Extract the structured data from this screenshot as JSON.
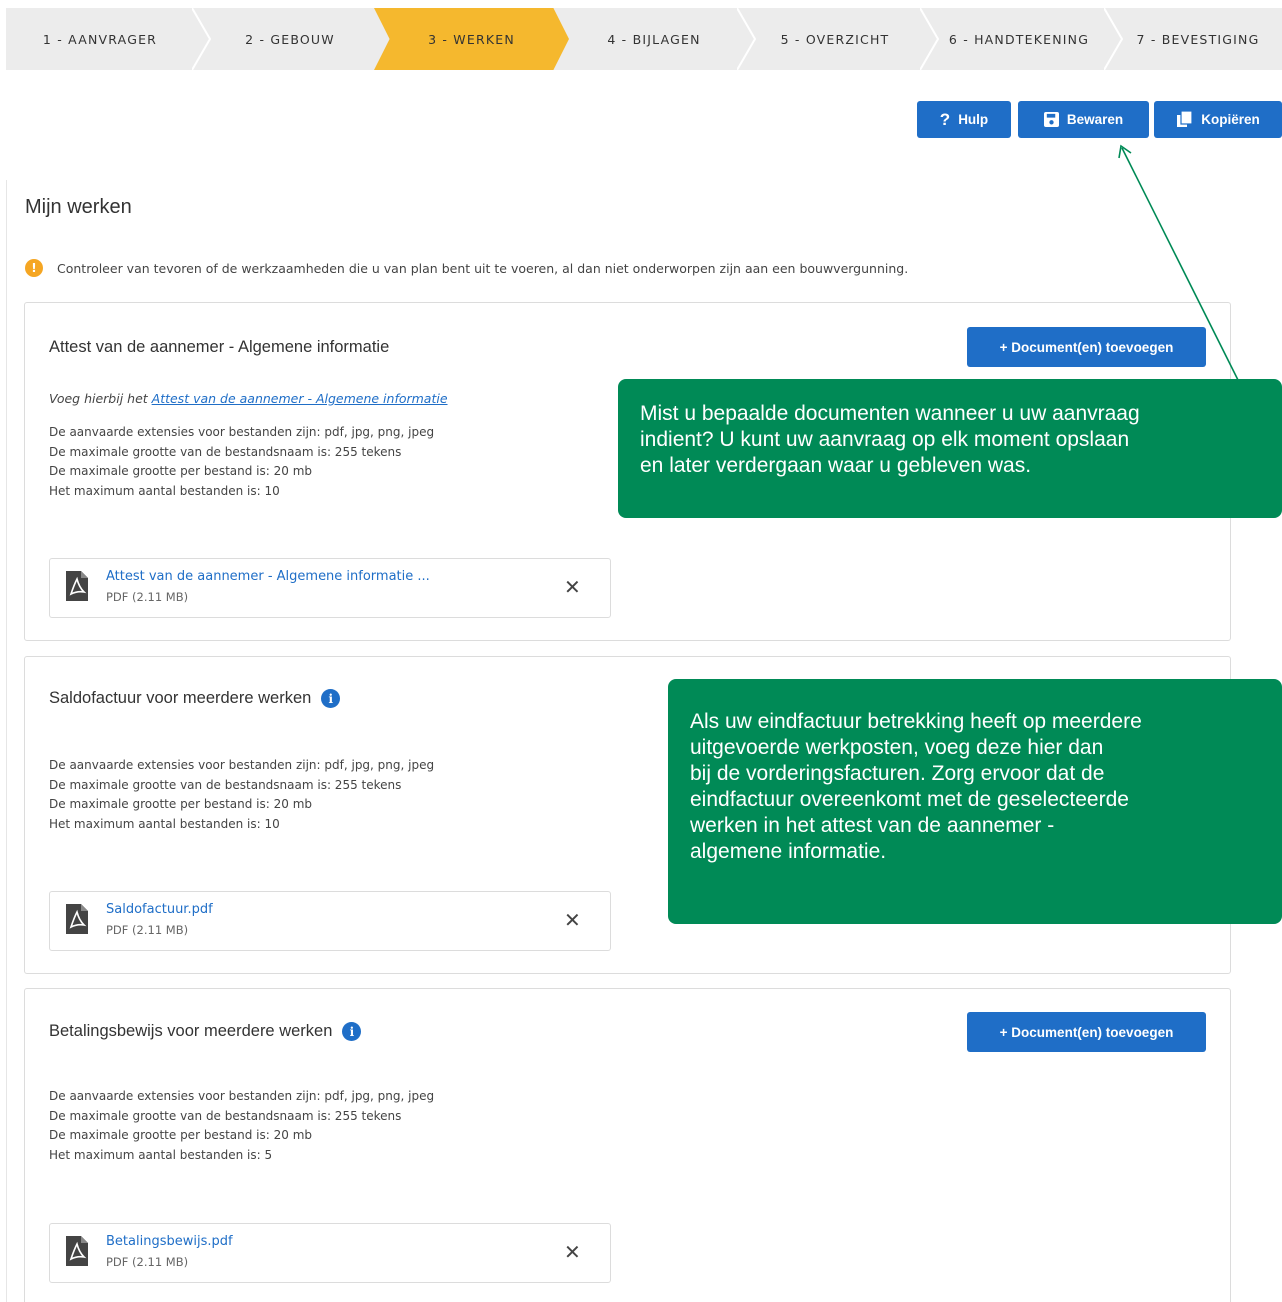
{
  "stepper": {
    "steps": [
      {
        "label": "1 - AANVRAGER"
      },
      {
        "label": "2 - GEBOUW"
      },
      {
        "label": "3 - WERKEN"
      },
      {
        "label": "4 - BIJLAGEN"
      },
      {
        "label": "5 - OVERZICHT"
      },
      {
        "label": "6 - HANDTEKENING"
      },
      {
        "label": "7 - BEVESTIGING"
      }
    ],
    "active_index": 2
  },
  "toolbar": {
    "help_label": "Hulp",
    "save_label": "Bewaren",
    "copy_label": "Kopiëren"
  },
  "page": {
    "title": "Mijn werken",
    "notice": "Controleer van tevoren of de werkzaamheden die u van plan bent uit te voeren, al dan niet onderworpen zijn aan een bouwvergunning."
  },
  "cards": [
    {
      "title": "Attest van de aannemer - Algemene informatie",
      "add_button": "+ Document(en) toevoegen",
      "intro_prefix": "Voeg hierbij het ",
      "intro_link": "Attest van de aannemer - Algemene informatie",
      "rules": [
        "De aanvaarde extensies voor bestanden zijn: pdf, jpg, png, jpeg",
        "De maximale grootte van de bestandsnaam is: 255 tekens",
        "De maximale grootte per bestand is: 20 mb",
        "Het maximum aantal bestanden is: 10"
      ],
      "file": {
        "name": "Attest van de aannemer - Algemene informatie ...",
        "meta": "PDF (2.11 MB)"
      }
    },
    {
      "title": "Saldofactuur voor meerdere werken",
      "rules": [
        "De aanvaarde extensies voor bestanden zijn: pdf, jpg, png, jpeg",
        "De maximale grootte van de bestandsnaam is: 255 tekens",
        "De maximale grootte per bestand is: 20 mb",
        "Het maximum aantal bestanden is: 10"
      ],
      "file": {
        "name": "Saldofactuur.pdf",
        "meta": "PDF (2.11 MB)"
      }
    },
    {
      "title": "Betalingsbewijs voor meerdere werken",
      "add_button": "+ Document(en) toevoegen",
      "rules": [
        "De aanvaarde extensies voor bestanden zijn: pdf, jpg, png, jpeg",
        "De maximale grootte van de bestandsnaam is: 255 tekens",
        "De maximale grootte per bestand is: 20 mb",
        "Het maximum aantal bestanden is: 5"
      ],
      "file": {
        "name": "Betalingsbewijs.pdf",
        "meta": "PDF (2.11 MB)"
      }
    }
  ],
  "tips": {
    "save_tip": [
      "Mist u bepaalde documenten wanneer u uw aanvraag",
      "indient? U kunt uw aanvraag op elk moment opslaan",
      "en later verdergaan waar u gebleven was."
    ],
    "invoice_tip": [
      "Als uw eindfactuur betrekking heeft op meerdere",
      "uitgevoerde werkposten, voeg deze hier dan",
      "bij de vorderingsfacturen. Zorg ervoor dat de",
      "eindfactuur overeenkomt met de geselecteerde",
      "werken in het attest van de aannemer -",
      "algemene informatie."
    ]
  },
  "colors": {
    "primary": "#1f6ec7",
    "active_step": "#f5b82e",
    "tip_green": "#008a56",
    "warning": "#f5a623"
  }
}
